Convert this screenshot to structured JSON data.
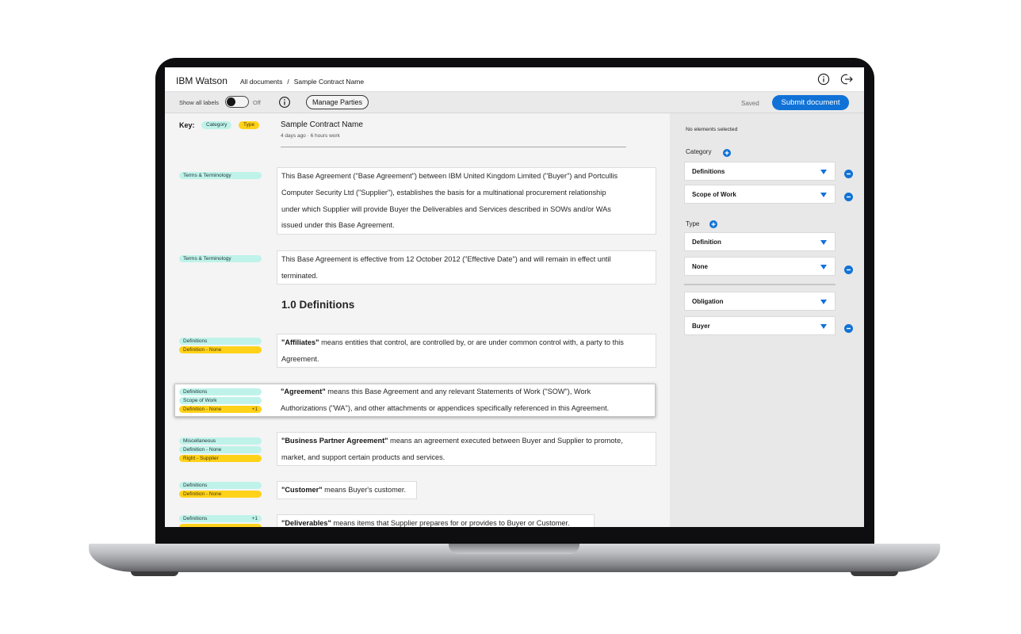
{
  "header": {
    "brand": "IBM Watson",
    "breadcrumb": [
      "All documents",
      "/",
      "Sample Contract Name"
    ]
  },
  "toolbar": {
    "show_labels": "Show all labels",
    "toggle_state": "Off",
    "manage_parties": "Manage Parties",
    "saved": "Saved",
    "submit": "Submit document"
  },
  "key": {
    "label": "Key:",
    "category": "Category",
    "type": "Type"
  },
  "document": {
    "title": "Sample Contract Name",
    "meta": "4 days ago  ·  6 hours work",
    "heading": "1.0 Definitions",
    "paragraphs": [
      {
        "tags": [
          {
            "kind": "cat",
            "label": "Terms & Terminology"
          }
        ],
        "lines": [
          "This Base Agreement (\"Base Agreement\") between IBM United Kingdom Limited (\"Buyer\") and Portcullis",
          "Computer Security Ltd (\"Supplier\"), establishes the basis for a multinational procurement relationship",
          "under which Supplier will provide Buyer the Deliverables and Services described in SOWs and/or WAs",
          "issued under this Base Agreement."
        ]
      },
      {
        "tags": [
          {
            "kind": "cat",
            "label": "Terms & Terminology"
          }
        ],
        "lines": [
          "This Base Agreement is effective from 12 October 2012 (\"Effective Date\") and will remain in effect until",
          "terminated."
        ]
      },
      {
        "tags": [
          {
            "kind": "cat",
            "label": "Definitions"
          },
          {
            "kind": "typ",
            "label": "Definition - None"
          }
        ],
        "term": "\"Affiliates\"",
        "lines": [
          " means entities that control, are controlled by, or are under common control with, a party to this",
          "Agreement."
        ]
      },
      {
        "tags": [
          {
            "kind": "cat",
            "label": "Definitions"
          },
          {
            "kind": "cat",
            "label": "Scope of Work"
          },
          {
            "kind": "typ",
            "label": "Definition - None",
            "extra": "+1"
          }
        ],
        "term": "\"Agreement\"",
        "lines": [
          " means this Base Agreement and any relevant Statements of Work (\"SOW\"), Work",
          "Authorizations (\"WA\"), and other attachments or appendices specifically referenced in this Agreement."
        ]
      },
      {
        "tags": [
          {
            "kind": "cat",
            "label": "Miscellaneous"
          },
          {
            "kind": "cat",
            "label": "Definition - None"
          },
          {
            "kind": "typ",
            "label": "Right - Supplier"
          }
        ],
        "term": "\"Business Partner Agreement\"",
        "lines": [
          " means an agreement executed between Buyer and Supplier to promote,",
          "market, and support certain products and services."
        ]
      },
      {
        "tags": [
          {
            "kind": "cat",
            "label": "Definitions"
          },
          {
            "kind": "typ",
            "label": "Definition - None"
          }
        ],
        "term": "\"Customer\"",
        "lines": [
          " means Buyer's customer."
        ]
      },
      {
        "tags": [
          {
            "kind": "cat",
            "label": "Definitions",
            "extra": "+1"
          }
        ],
        "term": "\"Deliverables\"",
        "lines": [
          " means items that Supplier prepares for or provides to Buyer or Customer."
        ]
      }
    ]
  },
  "panel": {
    "no_selection": "No elements selected",
    "category_label": "Category",
    "type_label": "Type",
    "category_values": [
      "Definitions",
      "Scope of Work"
    ],
    "type_values": [
      "Definition",
      "None"
    ],
    "extra_values": [
      "Obligation",
      "Buyer"
    ]
  },
  "colors": {
    "accent": "#1072d6",
    "category_tag": "#bff3ea",
    "type_tag": "#ffd21a"
  }
}
